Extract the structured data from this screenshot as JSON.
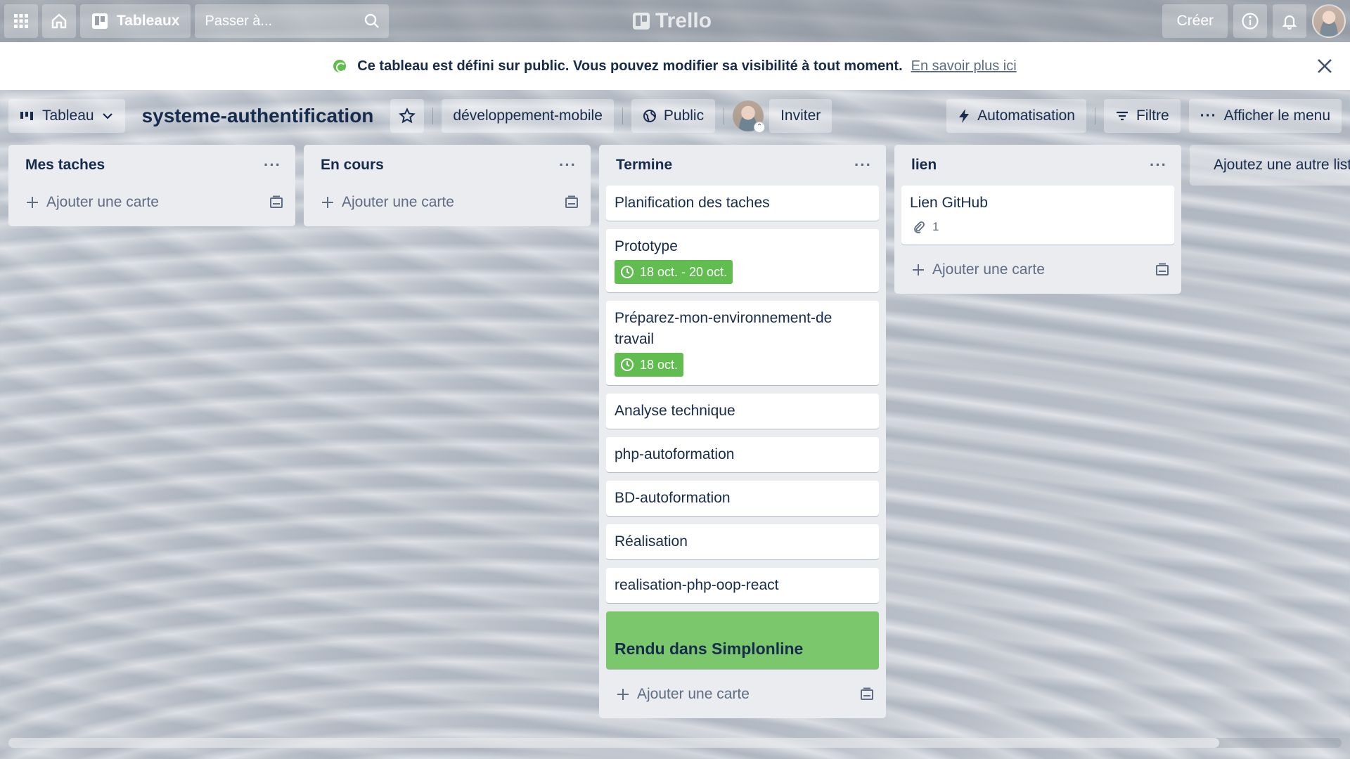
{
  "topnav": {
    "boards_label": "Tableaux",
    "search_placeholder": "Passer à...",
    "logo": "Trello",
    "create_label": "Créer"
  },
  "banner": {
    "text": "Ce tableau est défini sur public. Vous pouvez modifier sa visibilité à tout moment.",
    "link": "En savoir plus ici"
  },
  "board_header": {
    "view_label": "Tableau",
    "title": "systeme-authentification",
    "workspace": "développement-mobile",
    "visibility": "Public",
    "invite_label": "Inviter",
    "automation_label": "Automatisation",
    "filter_label": "Filtre",
    "menu_label": "Afficher le menu"
  },
  "lists": [
    {
      "title": "Mes taches",
      "menu": "···",
      "add_card": "Ajouter une carte",
      "cards": []
    },
    {
      "title": "En cours",
      "menu": "···",
      "add_card": "Ajouter une carte",
      "cards": []
    },
    {
      "title": "Termine",
      "menu": "···",
      "add_card": "Ajouter une carte",
      "cards": [
        {
          "title": "Planification des taches"
        },
        {
          "title": "Prototype",
          "due": "18 oct. - 20 oct."
        },
        {
          "title": "Préparez-mon-environnement-de travail",
          "due": "18 oct."
        },
        {
          "title": "Analyse technique"
        },
        {
          "title": "php-autoformation"
        },
        {
          "title": "BD-autoformation"
        },
        {
          "title": "Réalisation"
        },
        {
          "title": "realisation-php-oop-react"
        },
        {
          "title": "Rendu dans Simplonline",
          "cover": true
        }
      ]
    },
    {
      "title": "lien",
      "menu": "···",
      "add_card": "Ajouter une carte",
      "cards": [
        {
          "title": "Lien GitHub",
          "attachments": "1"
        }
      ]
    }
  ],
  "add_list_label": "Ajoutez une autre liste",
  "colors": {
    "due_green": "#61bd4f",
    "cover_green": "#7bc86c",
    "list_bg": "#ebecf0"
  }
}
